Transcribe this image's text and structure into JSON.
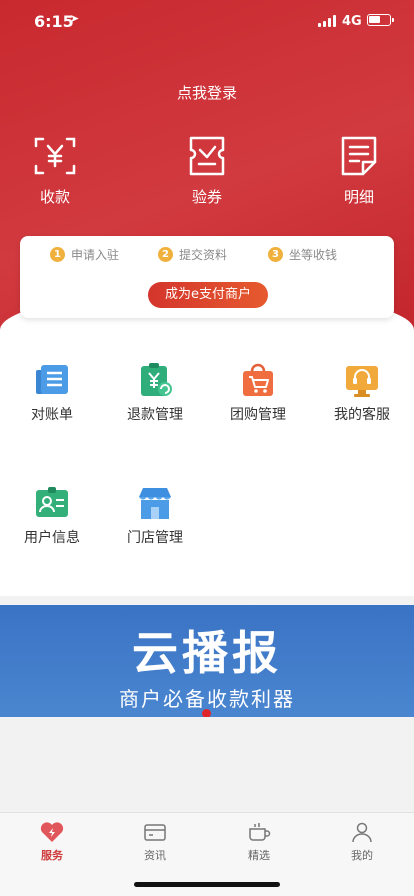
{
  "status_bar": {
    "time": "6:15",
    "network": "4G"
  },
  "header": {
    "login_text": "点我登录"
  },
  "quick_actions": [
    {
      "label": "收款",
      "icon": "scan-yuan-icon"
    },
    {
      "label": "验券",
      "icon": "ticket-verify-icon"
    },
    {
      "label": "明细",
      "icon": "document-detail-icon"
    }
  ],
  "steps": [
    {
      "num": "1",
      "label": "申请入驻"
    },
    {
      "num": "2",
      "label": "提交资料"
    },
    {
      "num": "3",
      "label": "坐等收钱"
    }
  ],
  "merchant_button": "成为e支付商户",
  "services": [
    {
      "label": "对账单",
      "icon": "statement-icon"
    },
    {
      "label": "退款管理",
      "icon": "refund-icon"
    },
    {
      "label": "团购管理",
      "icon": "group-buy-icon"
    },
    {
      "label": "我的客服",
      "icon": "customer-service-icon"
    },
    {
      "label": "用户信息",
      "icon": "user-info-icon"
    },
    {
      "label": "门店管理",
      "icon": "store-icon"
    }
  ],
  "banner": {
    "title": "云播报",
    "subtitle": "商户必备收款利器"
  },
  "tabs": [
    {
      "label": "服务",
      "icon": "heart-service-icon",
      "active": true
    },
    {
      "label": "资讯",
      "icon": "news-card-icon",
      "active": false
    },
    {
      "label": "精选",
      "icon": "coffee-cup-icon",
      "active": false
    },
    {
      "label": "我的",
      "icon": "person-icon",
      "active": false
    }
  ],
  "colors": {
    "brand_red": "#c8292f",
    "accent_orange": "#f0b03c",
    "banner_blue": "#3a73c4",
    "active_tab": "#d0393a"
  }
}
